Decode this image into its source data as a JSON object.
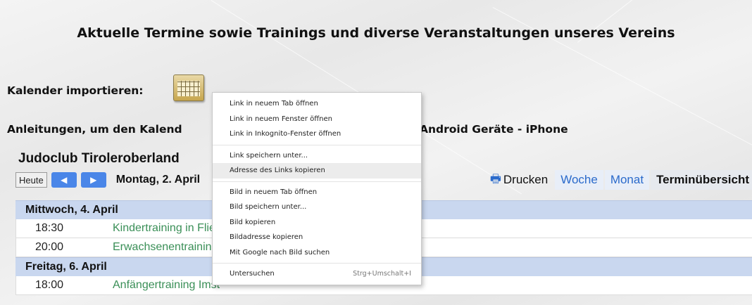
{
  "page": {
    "heading": "Aktuelle Termine sowie Trainings und diverse Veranstaltungen unseres Vereins",
    "import_label": "Kalender importieren:",
    "instructions_left": "Anleitungen, um den Kalend",
    "instructions_right": "Android Geräte - iPhone"
  },
  "calendar": {
    "club_name": "Judoclub Tiroleroberland",
    "today_button": "Heute",
    "current_date": "Montag, 2. April",
    "print_label": "Drucken",
    "tabs": [
      {
        "label": "Woche"
      },
      {
        "label": "Monat"
      },
      {
        "label": "Terminübersicht"
      }
    ],
    "days": [
      {
        "label": "Mittwoch, 4. April",
        "events": [
          {
            "time": "18:30",
            "title": "Kindertraining in Flie"
          },
          {
            "time": "20:00",
            "title": "Erwachsenentrainin"
          }
        ]
      },
      {
        "label": "Freitag, 6. April",
        "events": [
          {
            "time": "18:00",
            "title": "Anfängertraining Imst"
          }
        ]
      }
    ]
  },
  "context_menu": {
    "groups": [
      [
        {
          "label": "Link in neuem Tab öffnen"
        },
        {
          "label": "Link in neuem Fenster öffnen"
        },
        {
          "label": "Link in Inkognito-Fenster öffnen"
        }
      ],
      [
        {
          "label": "Link speichern unter..."
        },
        {
          "label": "Adresse des Links kopieren"
        }
      ],
      [
        {
          "label": "Bild in neuem Tab öffnen"
        },
        {
          "label": "Bild speichern unter..."
        },
        {
          "label": "Bild kopieren"
        },
        {
          "label": "Bildadresse kopieren"
        },
        {
          "label": "Mit Google nach Bild suchen"
        }
      ],
      [
        {
          "label": "Untersuchen",
          "shortcut": "Strg+Umschalt+I"
        }
      ]
    ],
    "highlighted": "Adresse des Links kopieren"
  },
  "colors": {
    "tab_link": "#2a6acb",
    "event_link": "#3a8f57",
    "day_header_bg": "#c9d7ef",
    "nav_button": "#4a86e8"
  }
}
